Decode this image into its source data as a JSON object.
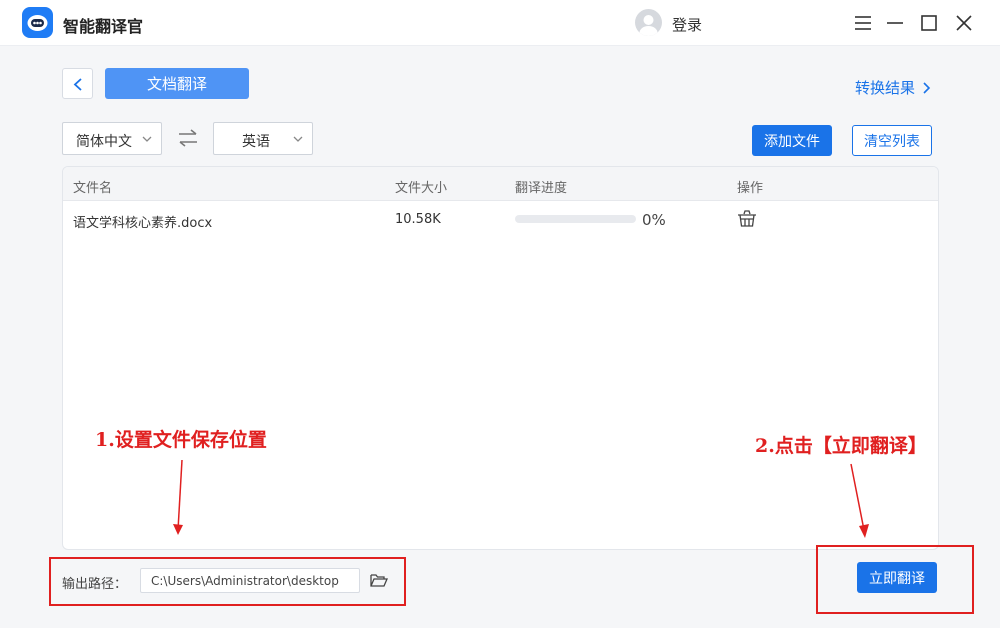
{
  "app": {
    "title": "智能翻译官",
    "accent": "#1a73e8"
  },
  "header": {
    "login_label": "登录"
  },
  "toolbar": {
    "tab_label": "文档翻译",
    "result_link": "转换结果",
    "source_language": "简体中文",
    "target_language": "英语",
    "add_file_label": "添加文件",
    "clear_list_label": "清空列表"
  },
  "table": {
    "columns": [
      "文件名",
      "文件大小",
      "翻译进度",
      "操作"
    ],
    "rows": [
      {
        "filename": "语文学科核心素养.docx",
        "size": "10.58K",
        "progress_text": "0%",
        "progress": 0
      }
    ]
  },
  "annotations": {
    "step1": "1.设置文件保存位置",
    "step2": "2.点击【立即翻译】",
    "color": "#e02020"
  },
  "footer": {
    "output_label": "输出路径：",
    "output_path": "C:\\Users\\Administrator\\desktop",
    "translate_label": "立即翻译"
  }
}
